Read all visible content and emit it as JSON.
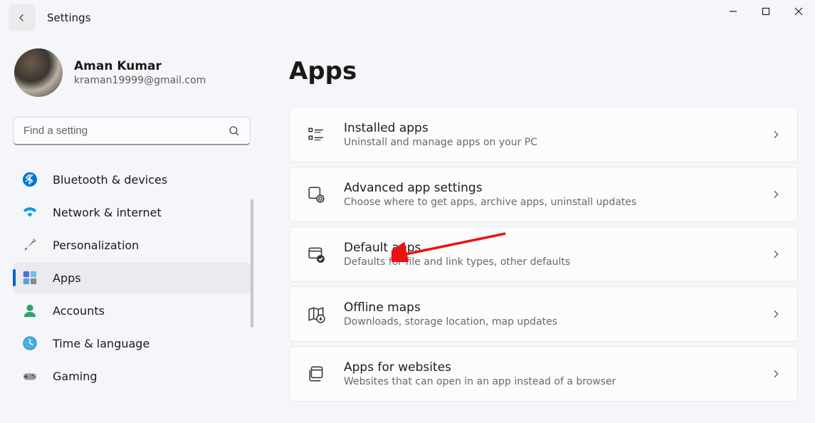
{
  "window": {
    "title": "Settings"
  },
  "profile": {
    "name": "Aman Kumar",
    "email": "kraman19999@gmail.com"
  },
  "search": {
    "placeholder": "Find a setting"
  },
  "sidebar": {
    "items": [
      {
        "label": "Bluetooth & devices"
      },
      {
        "label": "Network & internet"
      },
      {
        "label": "Personalization"
      },
      {
        "label": "Apps"
      },
      {
        "label": "Accounts"
      },
      {
        "label": "Time & language"
      },
      {
        "label": "Gaming"
      }
    ],
    "selected_index": 3
  },
  "page": {
    "title": "Apps"
  },
  "cards": [
    {
      "title": "Installed apps",
      "sub": "Uninstall and manage apps on your PC"
    },
    {
      "title": "Advanced app settings",
      "sub": "Choose where to get apps, archive apps, uninstall updates"
    },
    {
      "title": "Default apps",
      "sub": "Defaults for file and link types, other defaults"
    },
    {
      "title": "Offline maps",
      "sub": "Downloads, storage location, map updates"
    },
    {
      "title": "Apps for websites",
      "sub": "Websites that can open in an app instead of a browser"
    }
  ],
  "annotation": {
    "points_to_card": 2,
    "color": "#e11"
  }
}
